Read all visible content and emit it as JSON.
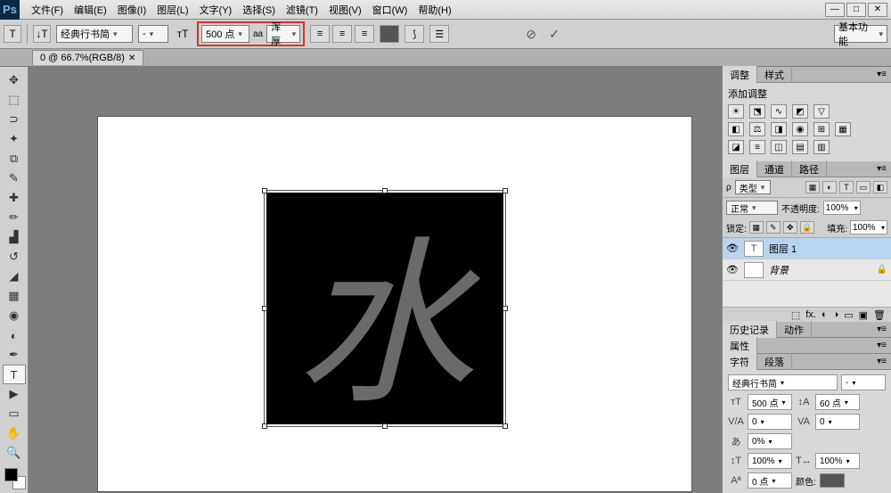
{
  "app_logo": "Ps",
  "menu": [
    "文件(F)",
    "编辑(E)",
    "图像(I)",
    "图层(L)",
    "文字(Y)",
    "选择(S)",
    "滤镜(T)",
    "视图(V)",
    "窗口(W)",
    "帮助(H)"
  ],
  "options": {
    "font_family": "经典行书简",
    "font_style": "-",
    "font_size": "500 点",
    "aa": "aa",
    "aa_mode": "浑厚",
    "workspace_dd": "基本功能"
  },
  "doc_tab": "0 @ 66.7%(RGB/8)",
  "canvas": {
    "glyph": "水"
  },
  "adjustments": {
    "tab": "调整",
    "tab2": "样式",
    "title": "添加调整"
  },
  "layers_panel": {
    "tabs": [
      "图层",
      "通道",
      "路径"
    ],
    "kind": "类型",
    "blend": "正常",
    "opacity_label": "不透明度:",
    "opacity": "100%",
    "lock_label": "锁定:",
    "fill_label": "填充:",
    "fill": "100%",
    "layers": [
      {
        "name": "图层 1",
        "type": "text",
        "selected": true,
        "locked": false
      },
      {
        "name": "背景",
        "type": "bg",
        "selected": false,
        "locked": true
      }
    ]
  },
  "history_tabs": [
    "历史记录",
    "动作"
  ],
  "props_tab": "属性",
  "char": {
    "tab": "字符",
    "tab2": "段落",
    "font": "经典行书简",
    "style": "-",
    "size": "500 点",
    "leading": "60 点",
    "va": "0",
    "tracking": "0",
    "scale": "0%",
    "tw": "100%",
    "th": "100%",
    "baseline": "0 点",
    "color_label": "颜色:"
  }
}
